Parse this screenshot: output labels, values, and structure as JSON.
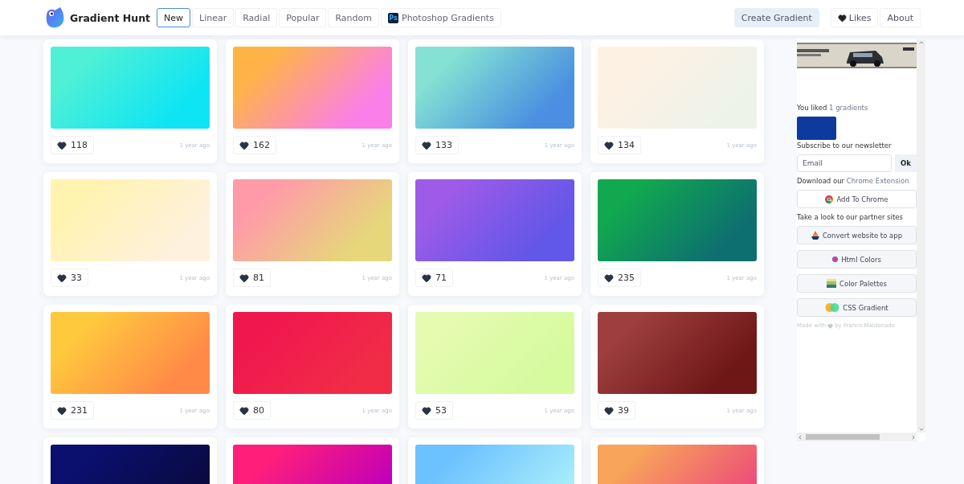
{
  "brand": {
    "name": "Gradient Hunt"
  },
  "nav_tabs": [
    {
      "label": "New",
      "selected": true
    },
    {
      "label": "Linear",
      "selected": false
    },
    {
      "label": "Radial",
      "selected": false
    },
    {
      "label": "Popular",
      "selected": false
    },
    {
      "label": "Random",
      "selected": false
    },
    {
      "label": "Photoshop Gradients",
      "selected": false,
      "badge": "Ps"
    }
  ],
  "nav_actions": [
    {
      "label": "Create Gradient",
      "kind": "primary"
    },
    {
      "label": "Likes",
      "kind": "likes"
    },
    {
      "label": "About",
      "kind": "plain"
    }
  ],
  "gradients": [
    {
      "colors": [
        {
          "color": "#4ff0d6"
        },
        {
          "color": "#0ee4f4"
        }
      ],
      "likes": "118",
      "time": "1 year ago"
    },
    {
      "colors": [
        {
          "color": "#ffb347"
        },
        {
          "color": "#fa7fe8"
        }
      ],
      "likes": "162",
      "time": "1 year ago"
    },
    {
      "colors": [
        {
          "color": "#84e1d4"
        },
        {
          "color": "#4a8fe0"
        }
      ],
      "likes": "133",
      "time": "1 year ago"
    },
    {
      "colors": [
        {
          "color": "#fdf1e3"
        },
        {
          "color": "#eef3ea"
        }
      ],
      "likes": "134",
      "time": "1 year ago"
    },
    {
      "colors": [
        {
          "color": "#fff3b0"
        },
        {
          "color": "#fef1dd"
        }
      ],
      "likes": "33",
      "time": "1 year ago"
    },
    {
      "colors": [
        {
          "color": "#ff9aa8"
        },
        {
          "color": "#e6d77a"
        }
      ],
      "likes": "81",
      "time": "1 year ago"
    },
    {
      "colors": [
        {
          "color": "#9d5be8"
        },
        {
          "color": "#6157e8"
        }
      ],
      "likes": "71",
      "time": "1 year ago"
    },
    {
      "colors": [
        {
          "color": "#11a84f"
        },
        {
          "color": "#0e6f70"
        }
      ],
      "likes": "235",
      "time": "1 year ago"
    },
    {
      "colors": [
        {
          "color": "#ffc93e"
        },
        {
          "color": "#ff8a47"
        }
      ],
      "likes": "231",
      "time": "1 year ago"
    },
    {
      "colors": [
        {
          "color": "#f0174f"
        },
        {
          "color": "#f02c46"
        }
      ],
      "likes": "80",
      "time": "1 year ago"
    },
    {
      "colors": [
        {
          "color": "#e4fbb0"
        },
        {
          "color": "#d6fa9e"
        }
      ],
      "likes": "53",
      "time": "1 year ago"
    },
    {
      "colors": [
        {
          "color": "#9e3e3e"
        },
        {
          "color": "#6e1717"
        }
      ],
      "likes": "39",
      "time": "1 year ago"
    },
    {
      "colors": [
        {
          "color": "#0b0f6e"
        },
        {
          "color": "#090a40"
        }
      ]
    },
    {
      "colors": [
        {
          "color": "#ff1f7a"
        },
        {
          "color": "#c200b8"
        }
      ]
    },
    {
      "colors": [
        {
          "color": "#6cc1ff"
        },
        {
          "color": "#a6ecfa"
        }
      ]
    },
    {
      "colors": [
        {
          "color": "#f8a45a"
        },
        {
          "color": "#ed4f78"
        }
      ]
    }
  ],
  "sidebar": {
    "liked": {
      "prefix": "You liked",
      "link": "1 gradients",
      "swatches": [
        {
          "color": "#0d3a9c"
        }
      ]
    },
    "newsletter": {
      "label": "Subscribe to our newsletter",
      "placeholder": "Email",
      "button": "Ok"
    },
    "extension": {
      "prefix": "Download our",
      "link": "Chrome Extension",
      "button": "Add To Chrome"
    },
    "partners_label": "Take a look to our partner sites",
    "partners": [
      {
        "label": "Convert website to app",
        "kind": "app"
      },
      {
        "label": "Html Colors",
        "kind": "dot"
      },
      {
        "label": "Color Palettes",
        "kind": "palette"
      },
      {
        "label": "CSS Gradient",
        "kind": "gradient"
      }
    ],
    "credit": {
      "prefix": "Made with",
      "suffix": "by Franco Maldonado"
    }
  }
}
